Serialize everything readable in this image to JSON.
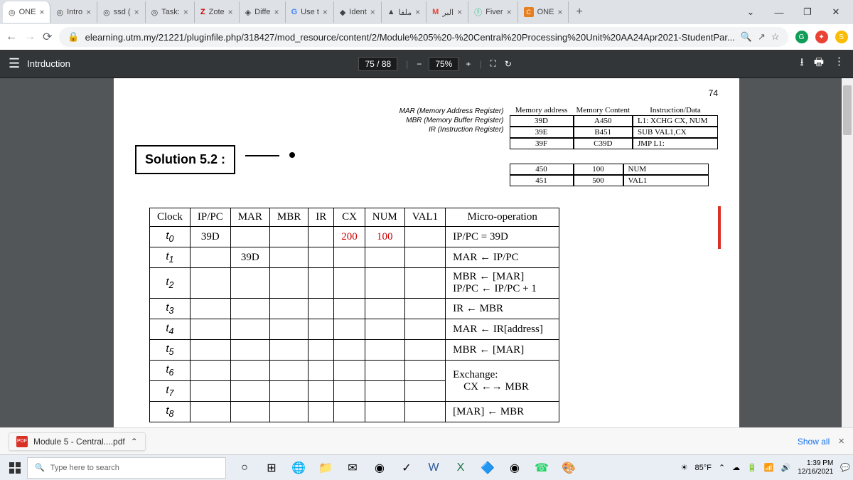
{
  "browser": {
    "tabs": [
      "ONE",
      "Intro",
      "ssd (",
      "Task:",
      "Zote",
      "Diffe",
      "Use t",
      "Ident",
      "ملفا",
      "البر",
      "Fiver",
      "ONE"
    ],
    "url": "elearning.utm.my/21221/pluginfile.php/318427/mod_resource/content/2/Module%205%20-%20Central%20Processing%20Unit%20AA24Apr2021-StudentPar..."
  },
  "pdf": {
    "title": "Intrduction",
    "page": "75",
    "total": "88",
    "zoom": "75%"
  },
  "page_number": "74",
  "registers": {
    "mar": "MAR (Memory Address Register)",
    "mbr": "MBR (Memory Buffer Register)",
    "ir": "IR (Instruction Register)"
  },
  "mem_headers": {
    "addr": "Memory address",
    "content": "Memory Content",
    "instr": "Instruction/Data"
  },
  "mem_rows": [
    {
      "a": "39D",
      "c": "A450",
      "i": "L1: XCHG  CX, NUM"
    },
    {
      "a": "39E",
      "c": "B451",
      "i": "SUB VAL1,CX"
    },
    {
      "a": "39F",
      "c": "C39D",
      "i": "JMP L1:"
    }
  ],
  "mem_rows2": [
    {
      "a": "450",
      "c": "100",
      "i": "NUM"
    },
    {
      "a": "451",
      "c": "500",
      "i": "VAL1"
    }
  ],
  "solution_label": "Solution 5.2 :",
  "micro": {
    "headers": [
      "Clock",
      "IP/PC",
      "MAR",
      "MBR",
      "IR",
      "CX",
      "NUM",
      "VAL1",
      "Micro-operation"
    ],
    "rows": [
      {
        "clock": "t",
        "sub": "0",
        "ippc": "39D",
        "mar": "",
        "mbr": "",
        "ir": "",
        "cx": "200",
        "num": "100",
        "val1": "",
        "op": "IP/PC = 39D"
      },
      {
        "clock": "t",
        "sub": "1",
        "ippc": "",
        "mar": "39D",
        "mbr": "",
        "ir": "",
        "cx": "",
        "num": "",
        "val1": "",
        "op": "MAR ← IP/PC"
      },
      {
        "clock": "t",
        "sub": "2",
        "ippc": "",
        "mar": "",
        "mbr": "",
        "ir": "",
        "cx": "",
        "num": "",
        "val1": "",
        "op": "MBR ← [MAR]\nIP/PC ← IP/PC + 1"
      },
      {
        "clock": "t",
        "sub": "3",
        "ippc": "",
        "mar": "",
        "mbr": "",
        "ir": "",
        "cx": "",
        "num": "",
        "val1": "",
        "op": "IR ← MBR"
      },
      {
        "clock": "t",
        "sub": "4",
        "ippc": "",
        "mar": "",
        "mbr": "",
        "ir": "",
        "cx": "",
        "num": "",
        "val1": "",
        "op": "MAR ← IR[address]"
      },
      {
        "clock": "t",
        "sub": "5",
        "ippc": "",
        "mar": "",
        "mbr": "",
        "ir": "",
        "cx": "",
        "num": "",
        "val1": "",
        "op": "MBR ← [MAR]"
      },
      {
        "clock": "t",
        "sub": "6",
        "ippc": "",
        "mar": "",
        "mbr": "",
        "ir": "",
        "cx": "",
        "num": "",
        "val1": "",
        "op": "Exchange:"
      },
      {
        "clock": "t",
        "sub": "7",
        "ippc": "",
        "mar": "",
        "mbr": "",
        "ir": "",
        "cx": "",
        "num": "",
        "val1": "",
        "op": "    CX ←→ MBR"
      },
      {
        "clock": "t",
        "sub": "8",
        "ippc": "",
        "mar": "",
        "mbr": "",
        "ir": "",
        "cx": "",
        "num": "",
        "val1": "",
        "op": "[MAR] ← MBR"
      }
    ]
  },
  "download": {
    "file": "Module 5 - Central....pdf",
    "showall": "Show all"
  },
  "taskbar": {
    "search": "Type here to search",
    "temp": "85°F",
    "time": "1:39 PM",
    "date": "12/16/2021"
  }
}
